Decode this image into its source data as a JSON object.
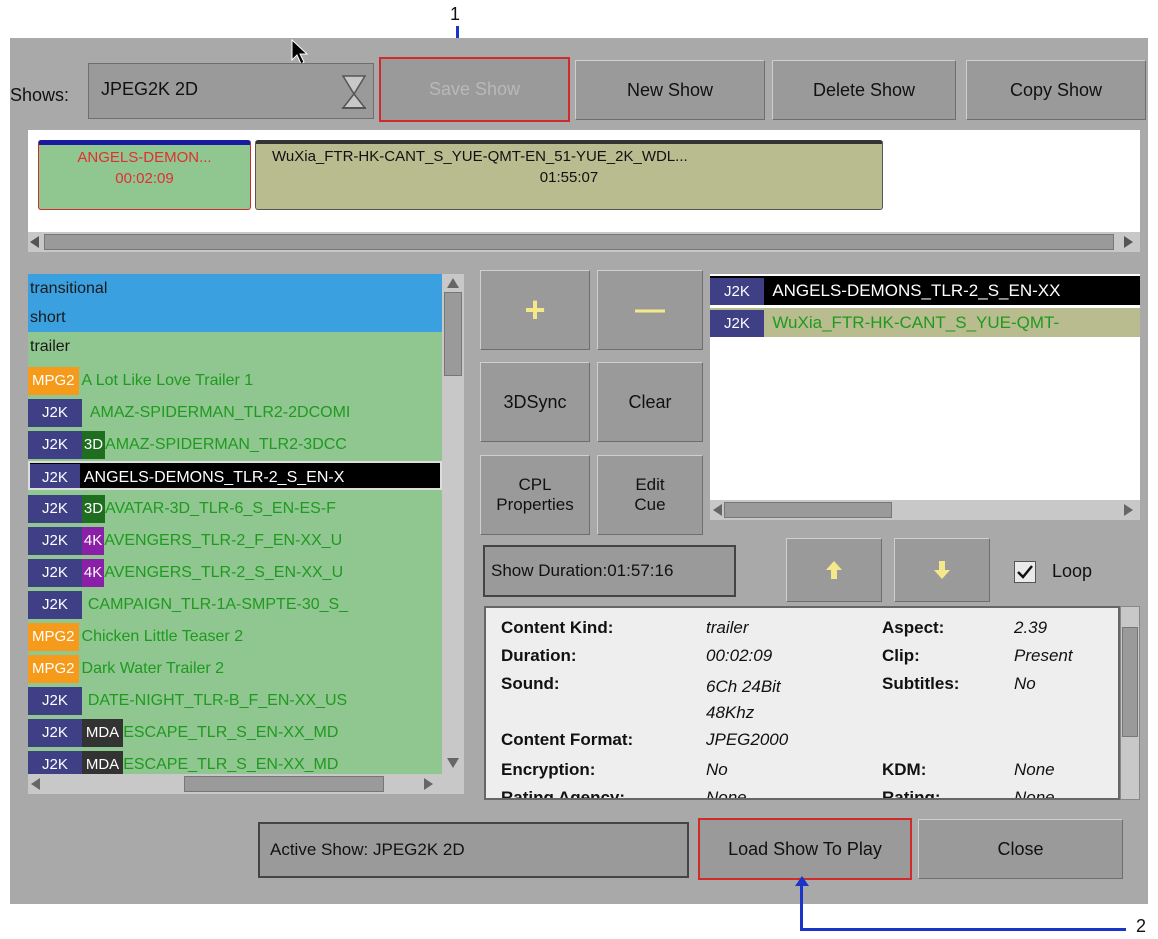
{
  "annotations": {
    "marker1": "1",
    "marker2": "2"
  },
  "header": {
    "shows_label": "Shows:",
    "shows_value": "JPEG2K 2D",
    "save_show": "Save Show",
    "new_show": "New Show",
    "delete_show": "Delete Show",
    "copy_show": "Copy Show"
  },
  "timeline": [
    {
      "title": "ANGELS-DEMON...",
      "duration": "00:02:09"
    },
    {
      "title": "WuXia_FTR-HK-CANT_S_YUE-QMT-EN_51-YUE_2K_WDL...",
      "duration": "01:55:07"
    }
  ],
  "library": {
    "groups": [
      "transitional",
      "short",
      "trailer"
    ],
    "items": [
      {
        "tag1": "MPG2",
        "tag2": "",
        "title": "A Lot Like Love Trailer 1"
      },
      {
        "tag1": "J2K",
        "tag2": "",
        "title": "AMAZ-SPIDERMAN_TLR2-2DCOMI"
      },
      {
        "tag1": "J2K",
        "tag2": "3D",
        "title": "AMAZ-SPIDERMAN_TLR2-3DCC"
      },
      {
        "tag1": "J2K",
        "tag2": "",
        "title": "ANGELS-DEMONS_TLR-2_S_EN-X"
      },
      {
        "tag1": "J2K",
        "tag2": "3D",
        "title": "AVATAR-3D_TLR-6_S_EN-ES-F"
      },
      {
        "tag1": "J2K",
        "tag2": "4K",
        "title": "AVENGERS_TLR-2_F_EN-XX_U"
      },
      {
        "tag1": "J2K",
        "tag2": "4K",
        "title": "AVENGERS_TLR-2_S_EN-XX_U"
      },
      {
        "tag1": "J2K",
        "tag2": "",
        "title": "CAMPAIGN_TLR-1A-SMPTE-30_S_"
      },
      {
        "tag1": "MPG2",
        "tag2": "",
        "title": "Chicken Little Teaser 2"
      },
      {
        "tag1": "MPG2",
        "tag2": "",
        "title": "Dark Water Trailer 2"
      },
      {
        "tag1": "J2K",
        "tag2": "",
        "title": "DATE-NIGHT_TLR-B_F_EN-XX_US"
      },
      {
        "tag1": "J2K",
        "tag2": "MDA",
        "title": "ESCAPE_TLR_S_EN-XX_MD"
      },
      {
        "tag1": "J2K",
        "tag2": "MDA",
        "title": "ESCAPE_TLR_S_EN-XX_MD"
      }
    ]
  },
  "controls": {
    "add": "+",
    "remove": "—",
    "sync3d": "3DSync",
    "clear": "Clear",
    "cpl_props": "CPL Properties",
    "edit_cue": "Edit Cue",
    "show_duration": "Show Duration:01:57:16",
    "loop": "Loop"
  },
  "playlist": [
    {
      "tag": "J2K",
      "title": "ANGELS-DEMONS_TLR-2_S_EN-XX"
    },
    {
      "tag": "J2K",
      "title": "WuXia_FTR-HK-CANT_S_YUE-QMT-"
    }
  ],
  "info": {
    "content_kind_label": "Content Kind:",
    "content_kind": "trailer",
    "aspect_label": "Aspect:",
    "aspect": "2.39",
    "duration_label": "Duration:",
    "duration": "00:02:09",
    "clip_label": "Clip:",
    "clip": "Present",
    "sound_label": "Sound:",
    "sound": "6Ch 24Bit 48Khz",
    "subtitles_label": "Subtitles:",
    "subtitles": "No",
    "content_format_label": "Content Format:",
    "content_format": "JPEG2000",
    "encryption_label": "Encryption:",
    "encryption": "No",
    "kdm_label": "KDM:",
    "kdm": "None",
    "rating_agency_label": "Rating Agency:",
    "rating_agency": "None",
    "rating_label": "Rating:",
    "rating": "None"
  },
  "footer": {
    "active_show": "Active Show: JPEG2K 2D",
    "load_show": "Load Show To Play",
    "close": "Close"
  },
  "colors": {
    "panel": "#a9a9a9",
    "selected_blue": "#3aa0e0",
    "list_green": "#90c690",
    "j2k_purple": "#3f3f86",
    "mpg2_orange": "#f59a1a",
    "tag_3d": "#1f6d1f",
    "tag_4k": "#8a1fa8",
    "tag_mda": "#333333",
    "highlight_red": "#d02a2a"
  }
}
